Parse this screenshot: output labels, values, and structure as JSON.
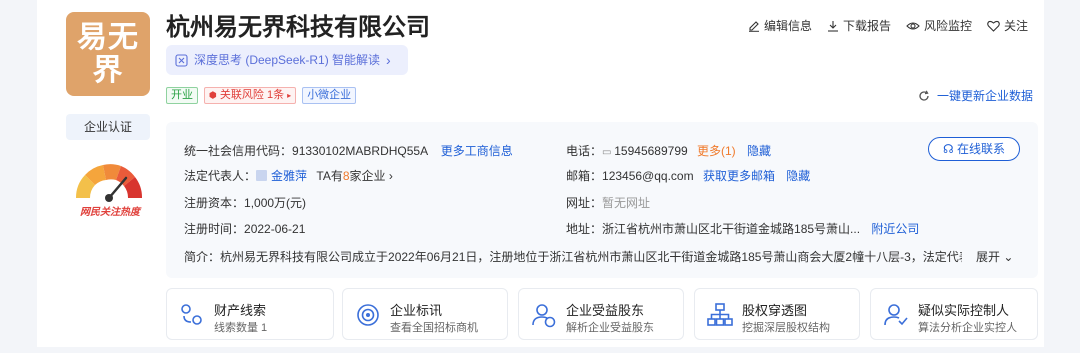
{
  "company": {
    "logo_text": "易无界",
    "name": "杭州易无界科技有限公司",
    "certification": "企业认证",
    "heat_label": "网民关注热度"
  },
  "actions": [
    {
      "label": "编辑信息",
      "icon": "edit-icon"
    },
    {
      "label": "下载报告",
      "icon": "download-icon"
    },
    {
      "label": "风险监控",
      "icon": "eye-icon"
    },
    {
      "label": "关注",
      "icon": "heart-icon"
    }
  ],
  "ai_banner": {
    "label": "深度思考 (DeepSeek-R1) 智能解读",
    "chevron": "›"
  },
  "tags": {
    "status": "开业",
    "risk": "关联风险 1条",
    "size": "小微企业"
  },
  "update_label": "一键更新企业数据",
  "info": {
    "credit_code_label": "统一社会信用代码：",
    "credit_code": "91330102MABRDHQ55A",
    "more_business": "更多工商信息",
    "legal_rep_label": "法定代表人：",
    "legal_rep": "金雅萍",
    "ta_prefix": "TA有",
    "ta_count": "8",
    "ta_suffix": "家企业 ›",
    "capital_label": "注册资本：",
    "capital": "1,000万(元)",
    "reg_date_label": "注册时间：",
    "reg_date": "2022-06-21",
    "phone_label": "电话：",
    "phone": "15945689799",
    "phone_more": "更多(1)",
    "hide": "隐藏",
    "email_label": "邮箱：",
    "email": "123456@qq.com",
    "email_more": "获取更多邮箱",
    "website_label": "网址：",
    "website": "暂无网址",
    "address_label": "地址：",
    "address": "浙江省杭州市萧山区北干街道金城路185号萧山...",
    "nearby": "附近公司",
    "intro_label": "简介：",
    "intro": "杭州易无界科技有限公司成立于2022年06月21日，注册地位于浙江省杭州市萧山区北干街道金城路185号萧山商会大厦2幢十八层-3，法定代表",
    "expand": "展开 ⌄",
    "contact": "在线联系"
  },
  "features": [
    {
      "title": "财产线索",
      "sub": "线索数量 1",
      "icon": "property-clue-icon"
    },
    {
      "title": "企业标讯",
      "sub": "查看全国招标商机",
      "icon": "target-icon"
    },
    {
      "title": "企业受益股东",
      "sub": "解析企业受益股东",
      "icon": "shareholder-icon"
    },
    {
      "title": "股权穿透图",
      "sub": "挖掘深层股权结构",
      "icon": "org-chart-icon"
    },
    {
      "title": "疑似实际控制人",
      "sub": "算法分析企业实控人",
      "icon": "controller-icon"
    }
  ],
  "colors": {
    "accent": "#1f5fd6",
    "logo_bg": "#dfa36a",
    "risk": "#e0403b",
    "open": "#2ba245",
    "more": "#f07a2b"
  }
}
